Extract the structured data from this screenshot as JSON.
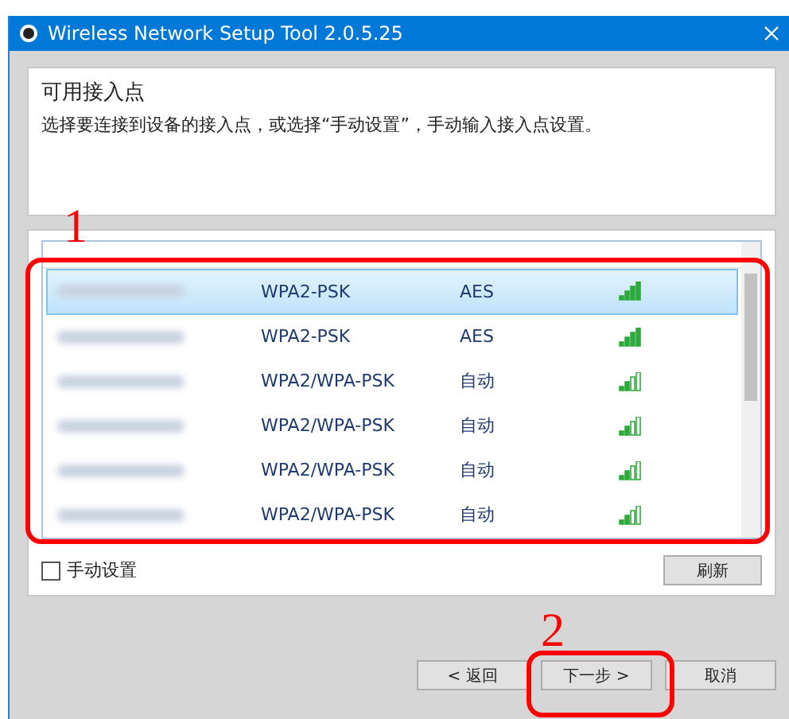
{
  "window": {
    "title": "Wireless Network Setup Tool 2.0.5.25"
  },
  "header": {
    "title": "可用接入点",
    "description": "选择要连接到设备的接入点，或选择“手动设置”，手动输入接入点设置。"
  },
  "table": {
    "rows": [
      {
        "authentication": "WPA2-PSK",
        "encryption": "AES",
        "full_signal": true,
        "selected": true
      },
      {
        "authentication": "WPA2-PSK",
        "encryption": "AES",
        "full_signal": true,
        "selected": false
      },
      {
        "authentication": "WPA2/WPA-PSK",
        "encryption": "自动",
        "full_signal": false,
        "selected": false
      },
      {
        "authentication": "WPA2/WPA-PSK",
        "encryption": "自动",
        "full_signal": false,
        "selected": false
      },
      {
        "authentication": "WPA2/WPA-PSK",
        "encryption": "自动",
        "full_signal": false,
        "selected": false
      },
      {
        "authentication": "WPA2/WPA-PSK",
        "encryption": "自动",
        "full_signal": false,
        "selected": false
      }
    ]
  },
  "manual_setup": {
    "label": "手动设置",
    "checked": false
  },
  "refresh_button": "刷新",
  "buttons": [
    "< 返回",
    "下一步 >",
    "取消"
  ],
  "annotations": [
    {
      "label": "1"
    },
    {
      "label": "2"
    }
  ]
}
